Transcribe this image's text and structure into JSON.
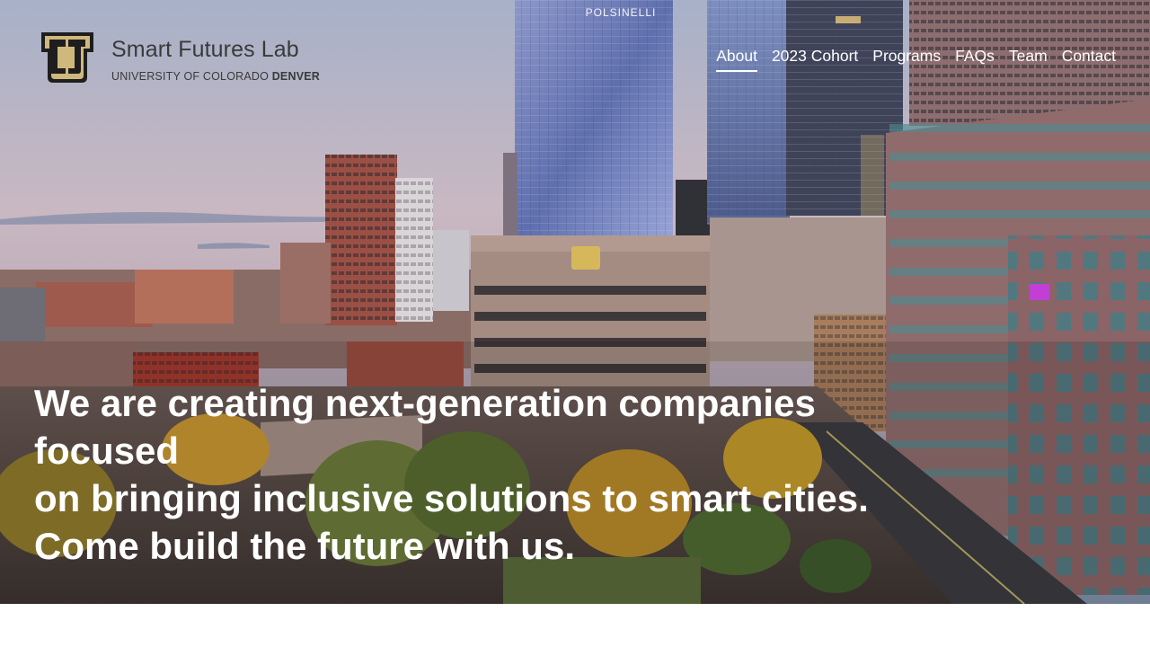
{
  "brand": {
    "title": "Smart Futures Lab",
    "subtitle_prefix": "UNIVERSITY OF COLORADO ",
    "subtitle_bold": "DENVER",
    "logo_icon": "cu-logo-icon",
    "accent": "#cfb87c"
  },
  "nav": {
    "items": [
      {
        "label": "About",
        "active": true
      },
      {
        "label": "2023 Cohort",
        "active": false
      },
      {
        "label": "Programs",
        "active": false
      },
      {
        "label": "FAQs",
        "active": false
      },
      {
        "label": "Team",
        "active": false
      },
      {
        "label": "Contact",
        "active": false
      }
    ]
  },
  "hero": {
    "building_sign": "POLSINELLI",
    "headline_lines": [
      "We are creating next-generation companies",
      "focused",
      "on bringing inclusive solutions to smart cities.",
      "Come build the future with us."
    ]
  }
}
